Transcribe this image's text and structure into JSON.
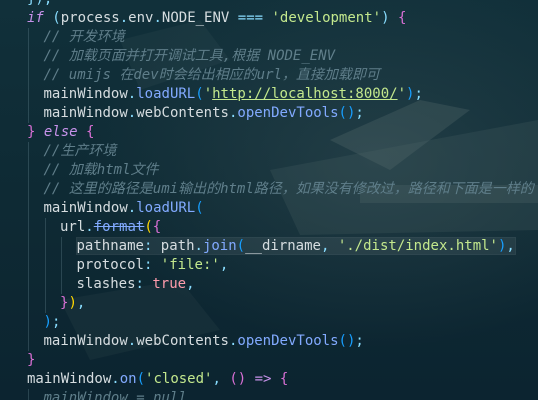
{
  "editor": {
    "lines": [
      {
        "indent": 0,
        "tokens": [
          {
            "t": "});",
            "c": "pun"
          }
        ]
      },
      {
        "indent": 0,
        "tokens": [
          {
            "t": "if",
            "c": "kw"
          },
          {
            "t": " (",
            "c": "pun"
          },
          {
            "t": "process",
            "c": "var"
          },
          {
            "t": ".",
            "c": "pun"
          },
          {
            "t": "env",
            "c": "prop"
          },
          {
            "t": ".",
            "c": "pun"
          },
          {
            "t": "NODE_ENV",
            "c": "prop"
          },
          {
            "t": " === ",
            "c": "op"
          },
          {
            "t": "'development'",
            "c": "str"
          },
          {
            "t": ") ",
            "c": "pun"
          },
          {
            "t": "{",
            "c": "brk2"
          }
        ]
      },
      {
        "indent": 1,
        "tokens": [
          {
            "t": "// 开发环境",
            "c": "cmt"
          }
        ]
      },
      {
        "indent": 1,
        "tokens": [
          {
            "t": "// 加载页面并打开调试工具,根据 NODE_ENV",
            "c": "cmt"
          }
        ]
      },
      {
        "indent": 1,
        "tokens": [
          {
            "t": "// umijs 在dev时会给出相应的url，直接加载即可",
            "c": "cmt"
          }
        ]
      },
      {
        "indent": 1,
        "tokens": [
          {
            "t": "mainWindow",
            "c": "var"
          },
          {
            "t": ".",
            "c": "pun"
          },
          {
            "t": "loadURL",
            "c": "fn"
          },
          {
            "t": "(",
            "c": "brk3"
          },
          {
            "t": "'",
            "c": "str"
          },
          {
            "t": "http://localhost:8000/",
            "c": "url"
          },
          {
            "t": "'",
            "c": "str"
          },
          {
            "t": ")",
            "c": "brk3"
          },
          {
            "t": ";",
            "c": "pun"
          }
        ]
      },
      {
        "indent": 1,
        "tokens": [
          {
            "t": "mainWindow",
            "c": "var"
          },
          {
            "t": ".",
            "c": "pun"
          },
          {
            "t": "webContents",
            "c": "prop"
          },
          {
            "t": ".",
            "c": "pun"
          },
          {
            "t": "openDevTools",
            "c": "fn"
          },
          {
            "t": "()",
            "c": "brk3"
          },
          {
            "t": ";",
            "c": "pun"
          }
        ]
      },
      {
        "indent": 0,
        "tokens": [
          {
            "t": "}",
            "c": "brk2"
          },
          {
            "t": " else ",
            "c": "kw"
          },
          {
            "t": "{",
            "c": "brk2"
          }
        ]
      },
      {
        "indent": 1,
        "tokens": [
          {
            "t": "//生产环境",
            "c": "cmt"
          }
        ]
      },
      {
        "indent": 1,
        "tokens": [
          {
            "t": "// 加载html文件",
            "c": "cmt"
          }
        ]
      },
      {
        "indent": 1,
        "tokens": [
          {
            "t": "// 这里的路径是umi输出的html路径，如果没有修改过，路径和下面是一样的",
            "c": "cmt"
          }
        ]
      },
      {
        "indent": 1,
        "tokens": [
          {
            "t": "mainWindow",
            "c": "var"
          },
          {
            "t": ".",
            "c": "pun"
          },
          {
            "t": "loadURL",
            "c": "fn"
          },
          {
            "t": "(",
            "c": "brk3"
          }
        ]
      },
      {
        "indent": 2,
        "tokens": [
          {
            "t": "url",
            "c": "var"
          },
          {
            "t": ".",
            "c": "pun"
          },
          {
            "t": "format",
            "c": "strike"
          },
          {
            "t": "(",
            "c": "brk1"
          },
          {
            "t": "{",
            "c": "brk2"
          }
        ]
      },
      {
        "indent": 3,
        "highlight": true,
        "tokens": [
          {
            "t": "pathname",
            "c": "prop"
          },
          {
            "t": ": ",
            "c": "pun"
          },
          {
            "t": "path",
            "c": "var"
          },
          {
            "t": ".",
            "c": "pun"
          },
          {
            "t": "join",
            "c": "fn"
          },
          {
            "t": "(",
            "c": "brk3"
          },
          {
            "t": "__dirname",
            "c": "var"
          },
          {
            "t": ", ",
            "c": "pun"
          },
          {
            "t": "'./dist/index.html'",
            "c": "str"
          },
          {
            "t": ")",
            "c": "brk3"
          },
          {
            "t": ",",
            "c": "pun"
          }
        ]
      },
      {
        "indent": 3,
        "tokens": [
          {
            "t": "protocol",
            "c": "prop"
          },
          {
            "t": ": ",
            "c": "pun"
          },
          {
            "t": "'file:'",
            "c": "str"
          },
          {
            "t": ",",
            "c": "pun"
          }
        ]
      },
      {
        "indent": 3,
        "tokens": [
          {
            "t": "slashes",
            "c": "prop"
          },
          {
            "t": ": ",
            "c": "pun"
          },
          {
            "t": "true",
            "c": "bool"
          },
          {
            "t": ",",
            "c": "pun"
          }
        ]
      },
      {
        "indent": 2,
        "tokens": [
          {
            "t": "}",
            "c": "brk2"
          },
          {
            "t": ")",
            "c": "brk1"
          },
          {
            "t": ",",
            "c": "pun"
          }
        ]
      },
      {
        "indent": 1,
        "tokens": [
          {
            "t": ")",
            "c": "brk3"
          },
          {
            "t": ";",
            "c": "pun"
          }
        ]
      },
      {
        "indent": 1,
        "tokens": [
          {
            "t": "mainWindow",
            "c": "var"
          },
          {
            "t": ".",
            "c": "pun"
          },
          {
            "t": "webContents",
            "c": "prop"
          },
          {
            "t": ".",
            "c": "pun"
          },
          {
            "t": "openDevTools",
            "c": "fn"
          },
          {
            "t": "()",
            "c": "brk3"
          },
          {
            "t": ";",
            "c": "pun"
          }
        ]
      },
      {
        "indent": 0,
        "tokens": [
          {
            "t": "}",
            "c": "brk2"
          }
        ]
      },
      {
        "indent": 0,
        "tokens": [
          {
            "t": "mainWindow",
            "c": "var"
          },
          {
            "t": ".",
            "c": "pun"
          },
          {
            "t": "on",
            "c": "fn"
          },
          {
            "t": "(",
            "c": "brk3"
          },
          {
            "t": "'closed'",
            "c": "str"
          },
          {
            "t": ", ",
            "c": "pun"
          },
          {
            "t": "() ",
            "c": "brk2"
          },
          {
            "t": "=> ",
            "c": "kw"
          },
          {
            "t": "{",
            "c": "brk2"
          }
        ]
      },
      {
        "indent": 1,
        "tokens": [
          {
            "t": "mainWindow = null",
            "c": "cmt"
          }
        ]
      }
    ]
  },
  "theme": {
    "background": "#0f2630",
    "comment": "#5f7e8a",
    "string": "#c3e88d",
    "function": "#82aaff",
    "keyword": "#c792ea"
  }
}
